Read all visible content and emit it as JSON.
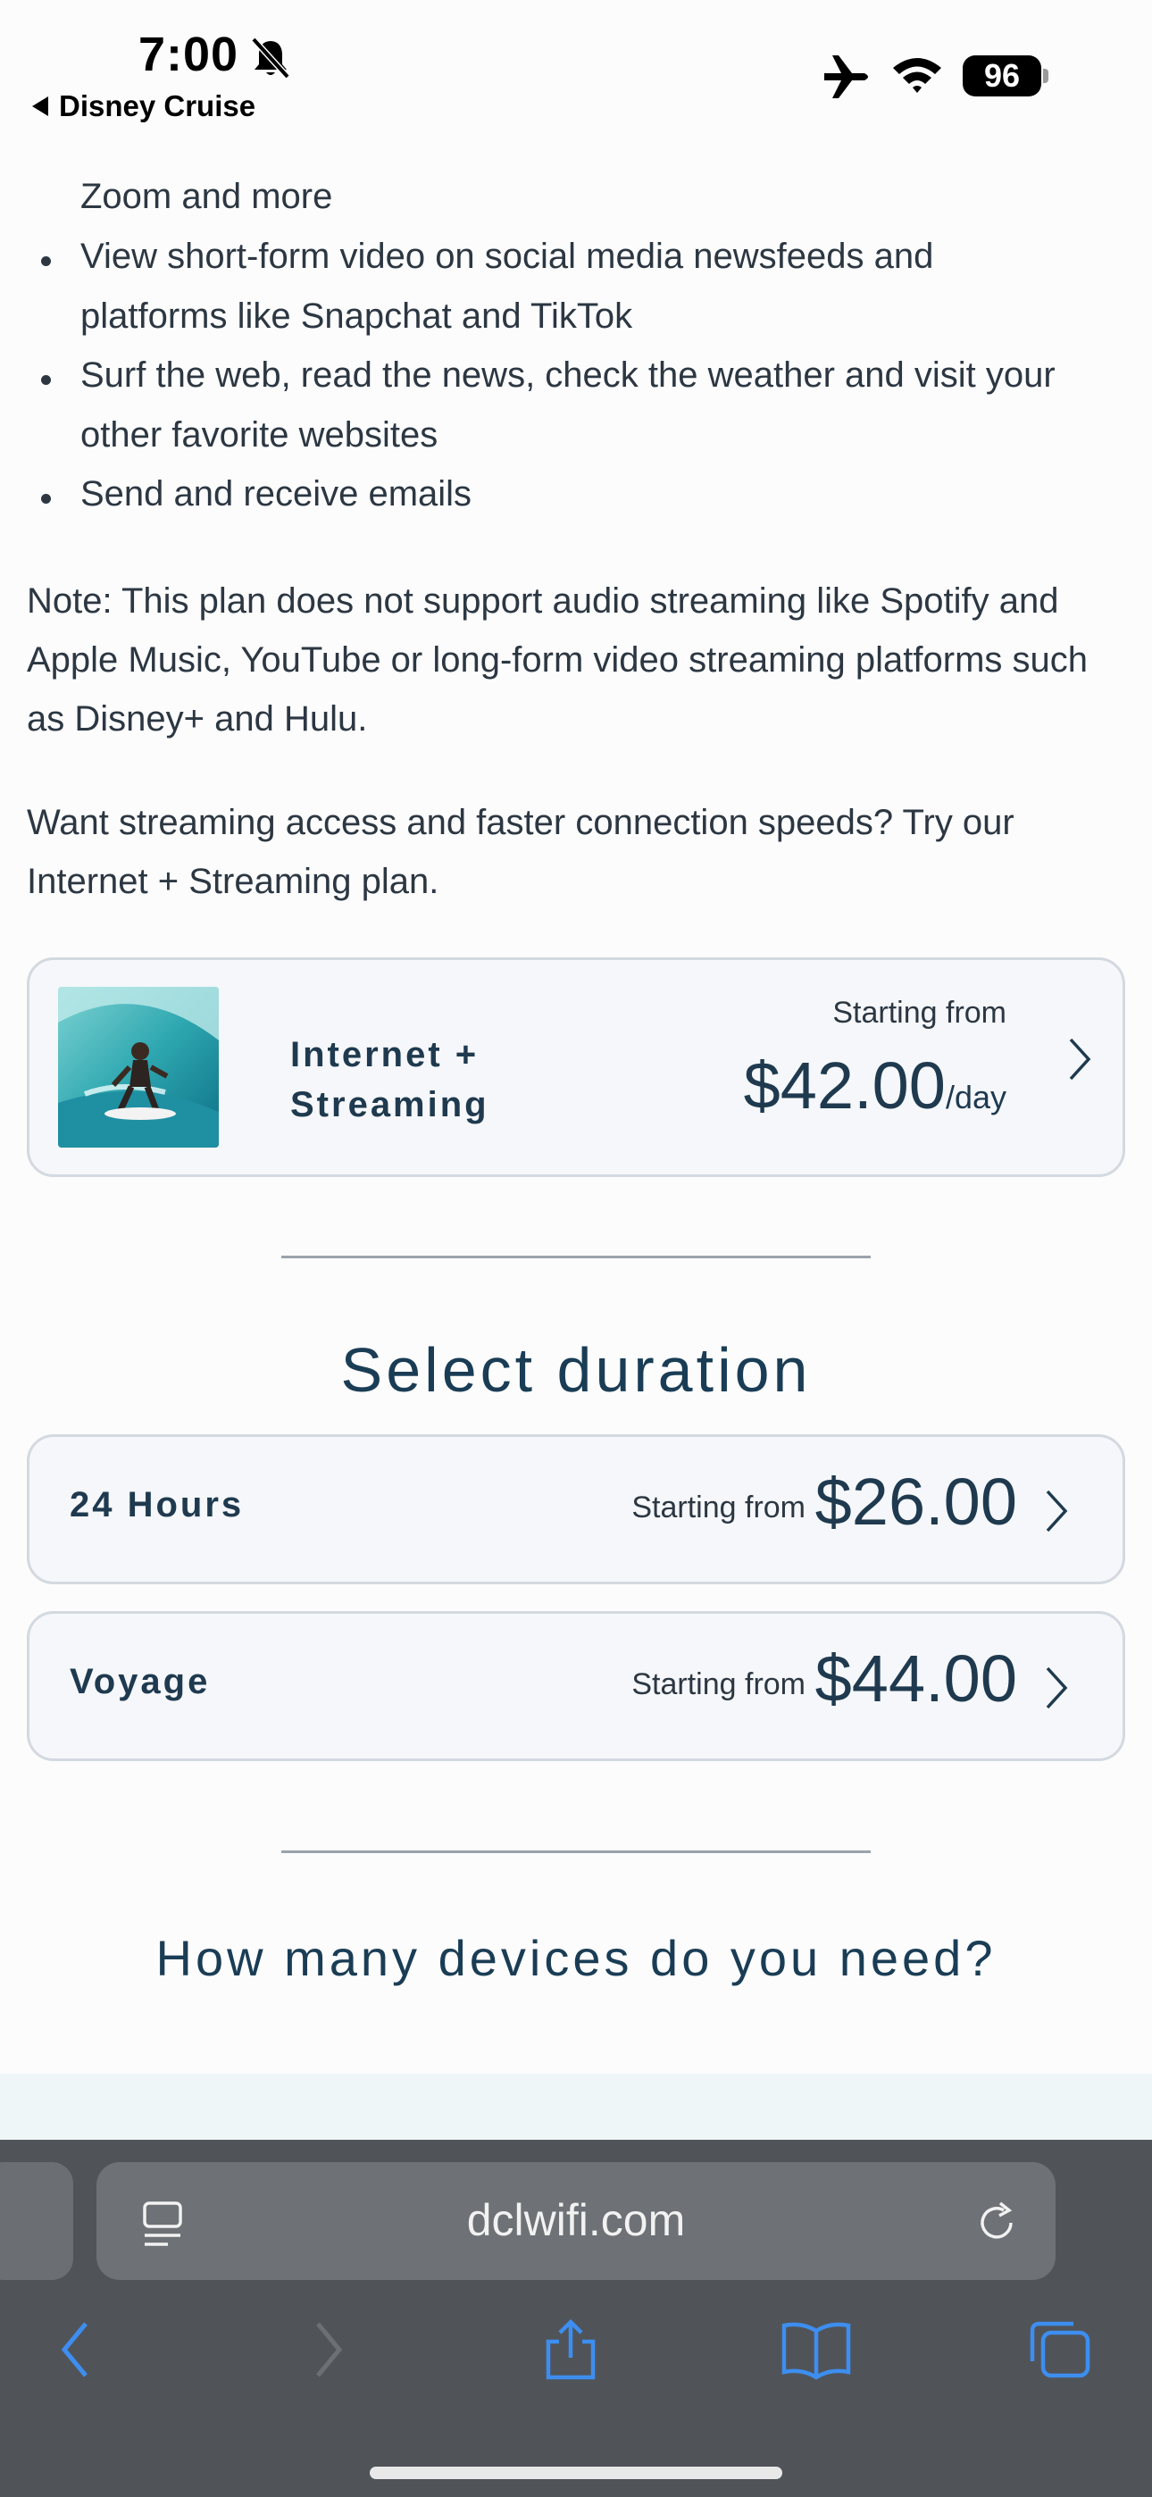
{
  "status_bar": {
    "time": "7:00",
    "back_app": "Disney Cruise",
    "battery": "96",
    "icons": [
      "bell-slash-icon",
      "airplane-icon",
      "wifi-icon",
      "battery-icon"
    ]
  },
  "content": {
    "bullets": [
      "Zoom and more",
      "View short-form video on social media newsfeeds and",
      "platforms like Snapchat and TikTok",
      "Surf the web, read the news, check the weather and visit your",
      "other favorite websites",
      "Send and receive emails"
    ],
    "note": "Note: This plan does not support audio streaming like Spotify and Apple Music, YouTube or long-form video streaming platforms such as Disney+ and Hulu.",
    "upsell": "Want streaming access and faster connection speeds? Try our Internet + Streaming plan."
  },
  "plan_card": {
    "name": "Internet + Streaming",
    "from_label": "Starting from",
    "price": "$42.00",
    "unit": "/day"
  },
  "duration": {
    "title": "Select duration",
    "options": [
      {
        "label": "24 Hours",
        "from_label": "Starting from",
        "price": "$26.00"
      },
      {
        "label": "Voyage",
        "from_label": "Starting from",
        "price": "$44.00"
      }
    ]
  },
  "devices": {
    "title": "How many devices do you need?"
  },
  "browser": {
    "url": "dclwifi.com",
    "toolbar": [
      "back-icon",
      "forward-icon",
      "share-icon",
      "bookmarks-icon",
      "tabs-icon"
    ],
    "accent": "#3d8ef0"
  }
}
